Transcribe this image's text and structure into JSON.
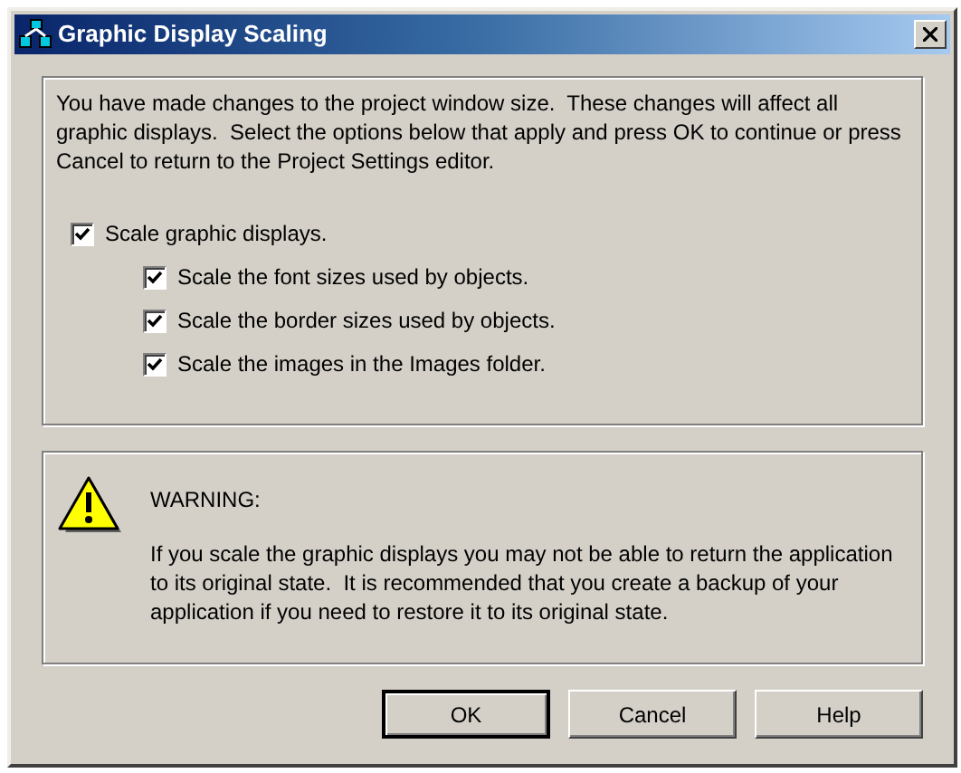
{
  "window": {
    "title": "Graphic Display Scaling"
  },
  "intro": "You have made changes to the project window size.  These changes will affect all graphic displays.  Select the options below that apply and press OK to continue or press Cancel to return to the Project Settings editor.",
  "main_option": {
    "label": "Scale graphic displays.",
    "checked": true
  },
  "sub_options": [
    {
      "label": "Scale the font sizes used by objects.",
      "checked": true
    },
    {
      "label": "Scale the border sizes used by objects.",
      "checked": true
    },
    {
      "label": "Scale the images in the Images folder.",
      "checked": true
    }
  ],
  "warning": {
    "heading": "WARNING:",
    "text": "If you scale the graphic displays you may not be able to return the application to its original state.  It is recommended that you create a backup of your application if you need to restore it to its original state."
  },
  "buttons": [
    {
      "label": "OK",
      "default": true
    },
    {
      "label": "Cancel",
      "default": false
    },
    {
      "label": "Help",
      "default": false
    }
  ]
}
